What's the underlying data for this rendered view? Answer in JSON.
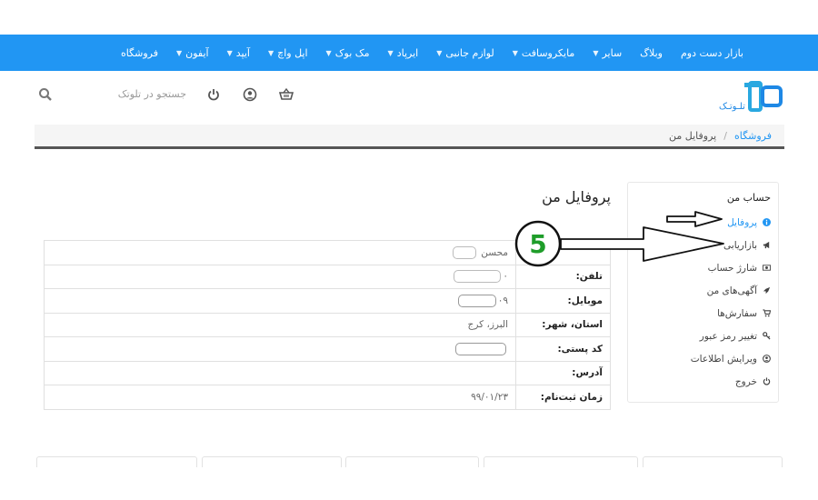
{
  "topnav": {
    "items": [
      {
        "label": "فروشگاه",
        "has_dropdown": false
      },
      {
        "label": "آیفون",
        "has_dropdown": true
      },
      {
        "label": "آیپد",
        "has_dropdown": true
      },
      {
        "label": "اپل واچ",
        "has_dropdown": true
      },
      {
        "label": "مک بوک",
        "has_dropdown": true
      },
      {
        "label": "ایرپاد",
        "has_dropdown": true
      },
      {
        "label": "لوازم جانبی",
        "has_dropdown": true
      },
      {
        "label": "مایکروسافت",
        "has_dropdown": true
      },
      {
        "label": "سایر",
        "has_dropdown": true
      },
      {
        "label": "وبلاگ",
        "has_dropdown": false
      },
      {
        "label": "بازار دست دوم",
        "has_dropdown": false
      }
    ]
  },
  "header": {
    "logo_text": "تلـوتـک",
    "search_placeholder": "جستجو در تلوتک",
    "icons": [
      "basket-icon",
      "user-icon",
      "power-icon",
      "search-icon"
    ]
  },
  "breadcrumb": {
    "home": "فروشگاه",
    "separator": "/",
    "current": "پروفایل من"
  },
  "sidebar": {
    "title": "حساب من",
    "items": [
      {
        "label": "پروفایل",
        "icon": "info-icon",
        "active": true
      },
      {
        "label": "بازاریابی",
        "icon": "megaphone-icon",
        "active": false
      },
      {
        "label": "شارژ حساب",
        "icon": "money-icon",
        "active": false
      },
      {
        "label": "آگهی‌های من",
        "icon": "rocket-icon",
        "active": false
      },
      {
        "label": "سفارش‌ها",
        "icon": "cart-icon",
        "active": false
      },
      {
        "label": "تغییر رمز عبور",
        "icon": "key-icon",
        "active": false
      },
      {
        "label": "ویرایش اطلاعات",
        "icon": "user-circle-icon",
        "active": false
      },
      {
        "label": "خروج",
        "icon": "power-icon",
        "active": false
      }
    ]
  },
  "main": {
    "title": "پروفایل من",
    "rows": [
      {
        "label": "",
        "value": "محسن"
      },
      {
        "label": "تلفن:",
        "value": "۰"
      },
      {
        "label": "موبایل:",
        "value": "۰۹"
      },
      {
        "label": "استان، شهر:",
        "value": "البرز، کرج"
      },
      {
        "label": "کد پستی:",
        "value": ""
      },
      {
        "label": "آدرس:",
        "value": ""
      },
      {
        "label": "زمان ثبت‌نام:",
        "value": "۹۹/۰۱/۲۳"
      }
    ]
  },
  "annotation": {
    "step_number": "5",
    "color": "#1f9d2a"
  },
  "colors": {
    "brand": "#2196f3",
    "nav_bg": "#2196f3",
    "crumb_bg": "#f5f5f5"
  }
}
